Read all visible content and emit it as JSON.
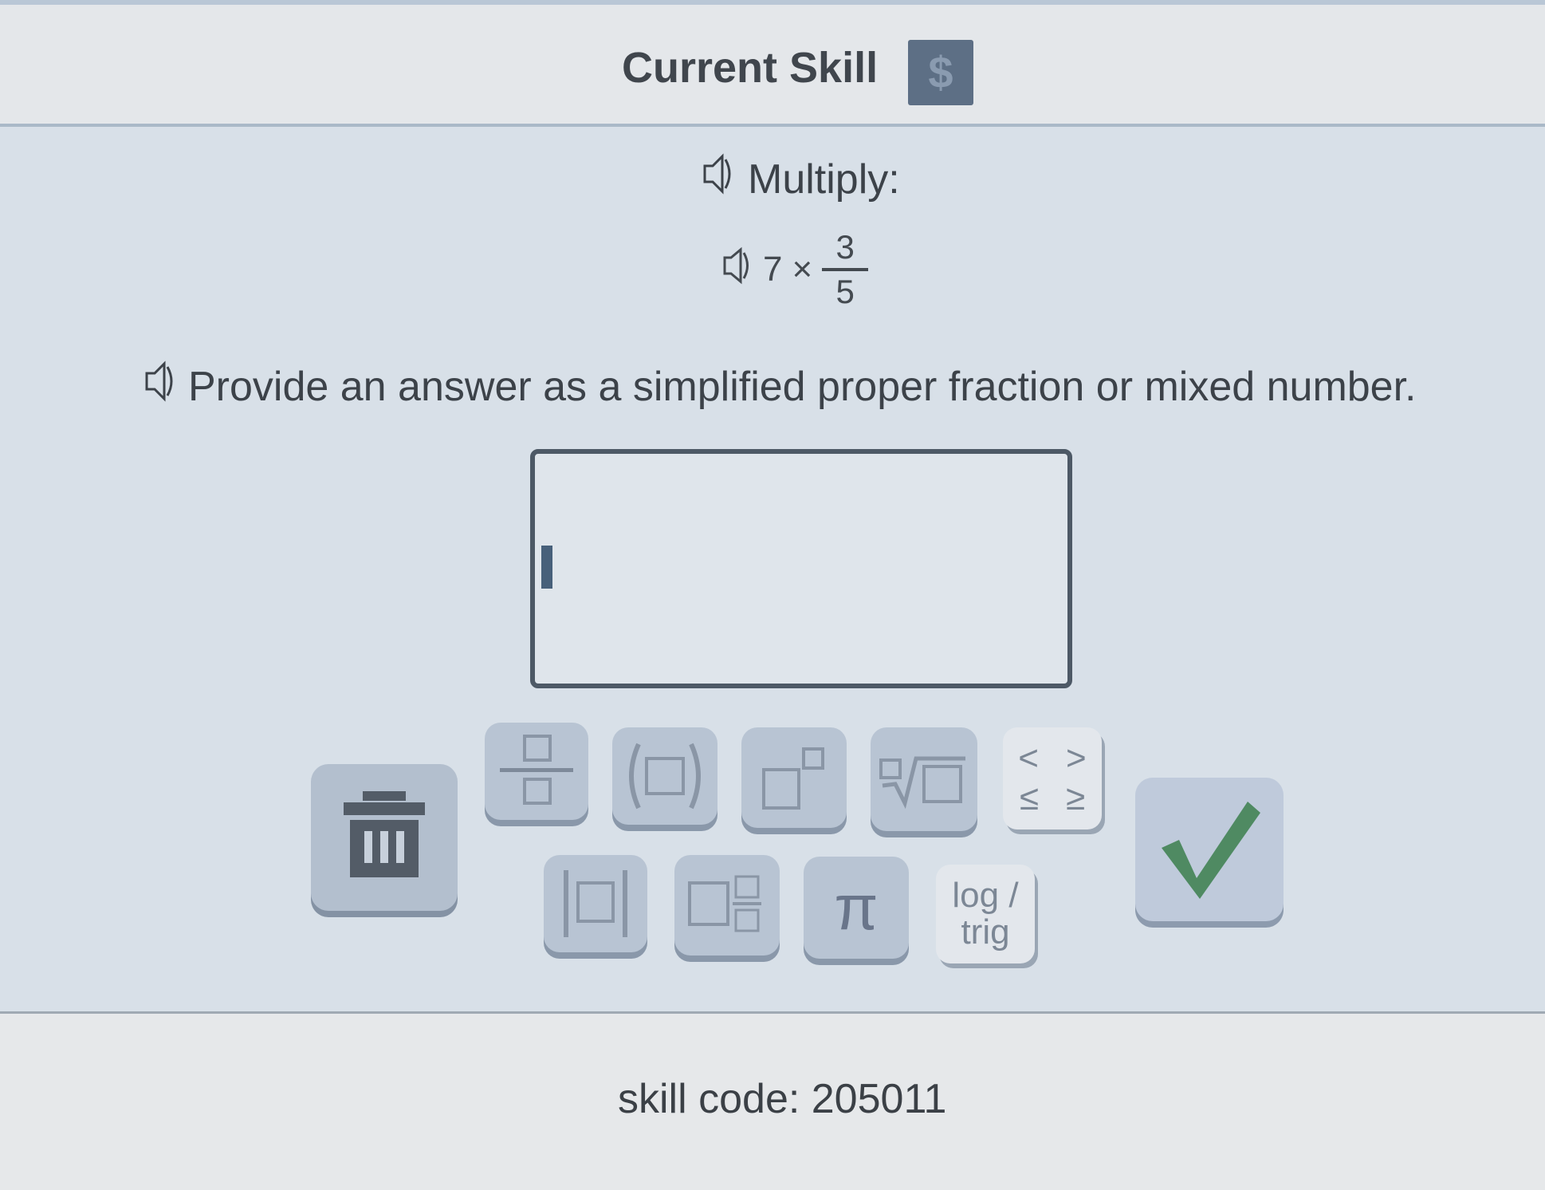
{
  "header": {
    "title": "Current Skill",
    "dollar_label": "$"
  },
  "question": {
    "prompt": "Multiply:",
    "expression": {
      "whole": "7",
      "operator": "×",
      "numerator": "3",
      "denominator": "5"
    },
    "instruction": "Provide an answer as a simplified proper fraction or mixed number."
  },
  "answer": {
    "value": ""
  },
  "keypad": {
    "pi_label": "π",
    "log_label_1": "log /",
    "log_label_2": "trig",
    "ineq_1": "<",
    "ineq_2": ">",
    "ineq_3": "≤",
    "ineq_4": "≥"
  },
  "footer": {
    "skill_code_text": "skill code: 205011"
  },
  "colors": {
    "check_green": "#4f8a62",
    "button_bg": "#b8c4d3",
    "dollar_bg": "#5d6f85"
  }
}
